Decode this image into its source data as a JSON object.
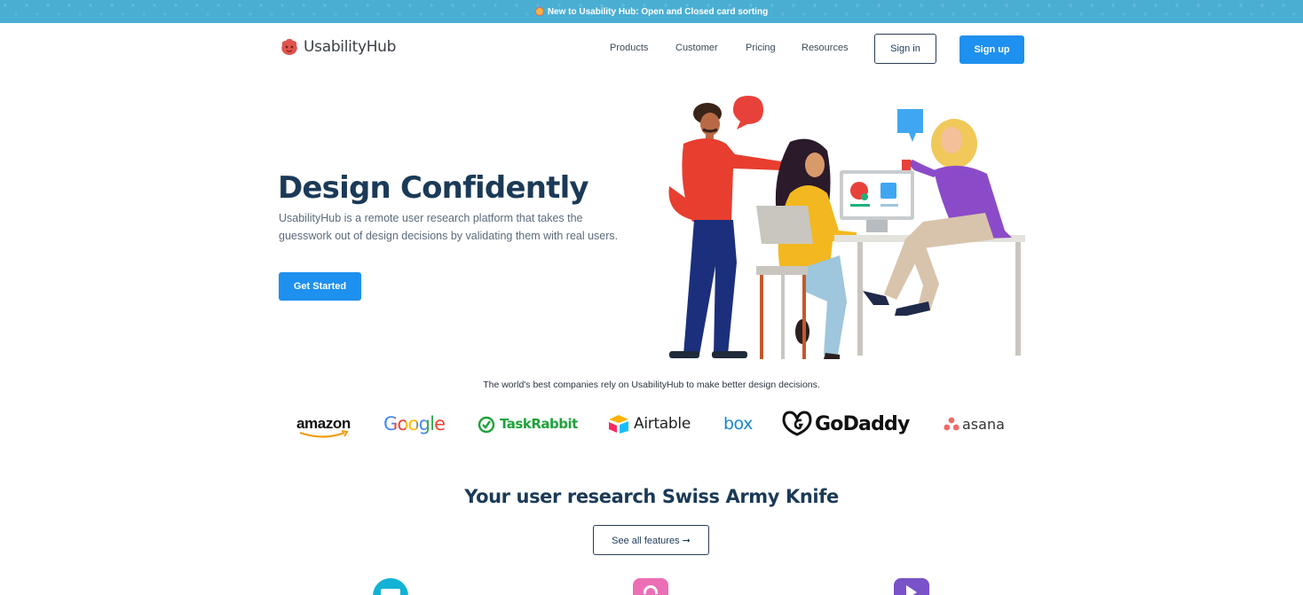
{
  "banner": {
    "icon": "gift-icon",
    "text": "New to Usability Hub: Open and Closed card sorting"
  },
  "nav": {
    "logo_text": "UsabilityHub",
    "links": [
      "Products",
      "Customer",
      "Pricing",
      "Resources"
    ],
    "signin_label": "Sign in",
    "signup_label": "Sign up"
  },
  "hero": {
    "title": "Design Confidently",
    "description": "UsabilityHub is a remote user research platform that takes the guesswork out of design decisions by validating them with real users.",
    "cta_label": "Get Started"
  },
  "trust": {
    "text": "The world's best companies rely on UsabilityHub to make better design decisions.",
    "logos": [
      "amazon",
      "Google",
      "TaskRabbit",
      "Airtable",
      "box",
      "GoDaddy",
      "asana"
    ]
  },
  "features": {
    "title": "Your user research Swiss Army Knife",
    "button_label": "See all features ➞",
    "icons": [
      "chat-icon",
      "arrow-up-icon",
      "send-icon"
    ]
  },
  "colors": {
    "brand_blue": "#1e90ef",
    "heading": "#1b3a57",
    "banner": "#4aaed3"
  }
}
